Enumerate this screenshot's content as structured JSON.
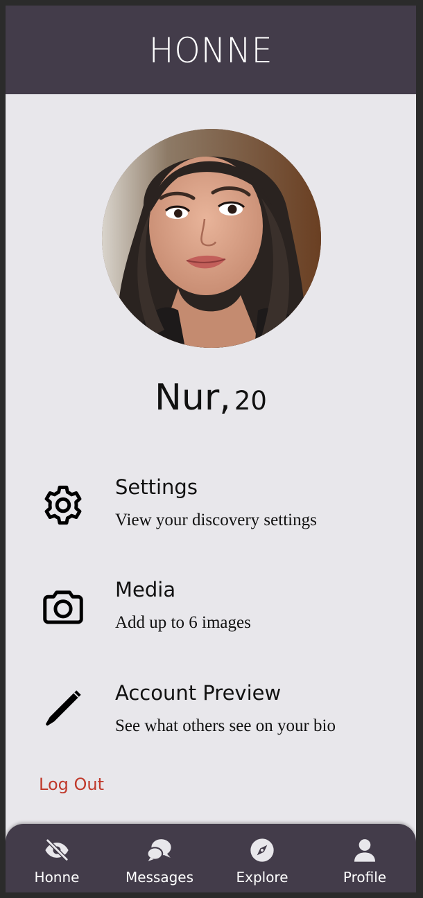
{
  "header": {
    "brand": "HONNE"
  },
  "profile": {
    "name": "Nur,",
    "age": "20",
    "avatar_alt": "profile photo"
  },
  "menu": [
    {
      "title": "Settings",
      "subtitle": "View your discovery settings",
      "icon": "gear-icon"
    },
    {
      "title": "Media",
      "subtitle": "Add up to 6 images",
      "icon": "camera-icon"
    },
    {
      "title": "Account Preview",
      "subtitle": "See what others see on your bio",
      "icon": "pencil-icon"
    }
  ],
  "logout_label": "Log Out",
  "tabs": [
    {
      "label": "Honne",
      "icon": "eye-slash-icon"
    },
    {
      "label": "Messages",
      "icon": "chat-bubbles-icon"
    },
    {
      "label": "Explore",
      "icon": "compass-icon"
    },
    {
      "label": "Profile",
      "icon": "person-icon"
    }
  ],
  "colors": {
    "header_bg": "#433c4a",
    "page_bg": "#e8e7eb",
    "logout": "#c0392b",
    "text": "#111111"
  }
}
